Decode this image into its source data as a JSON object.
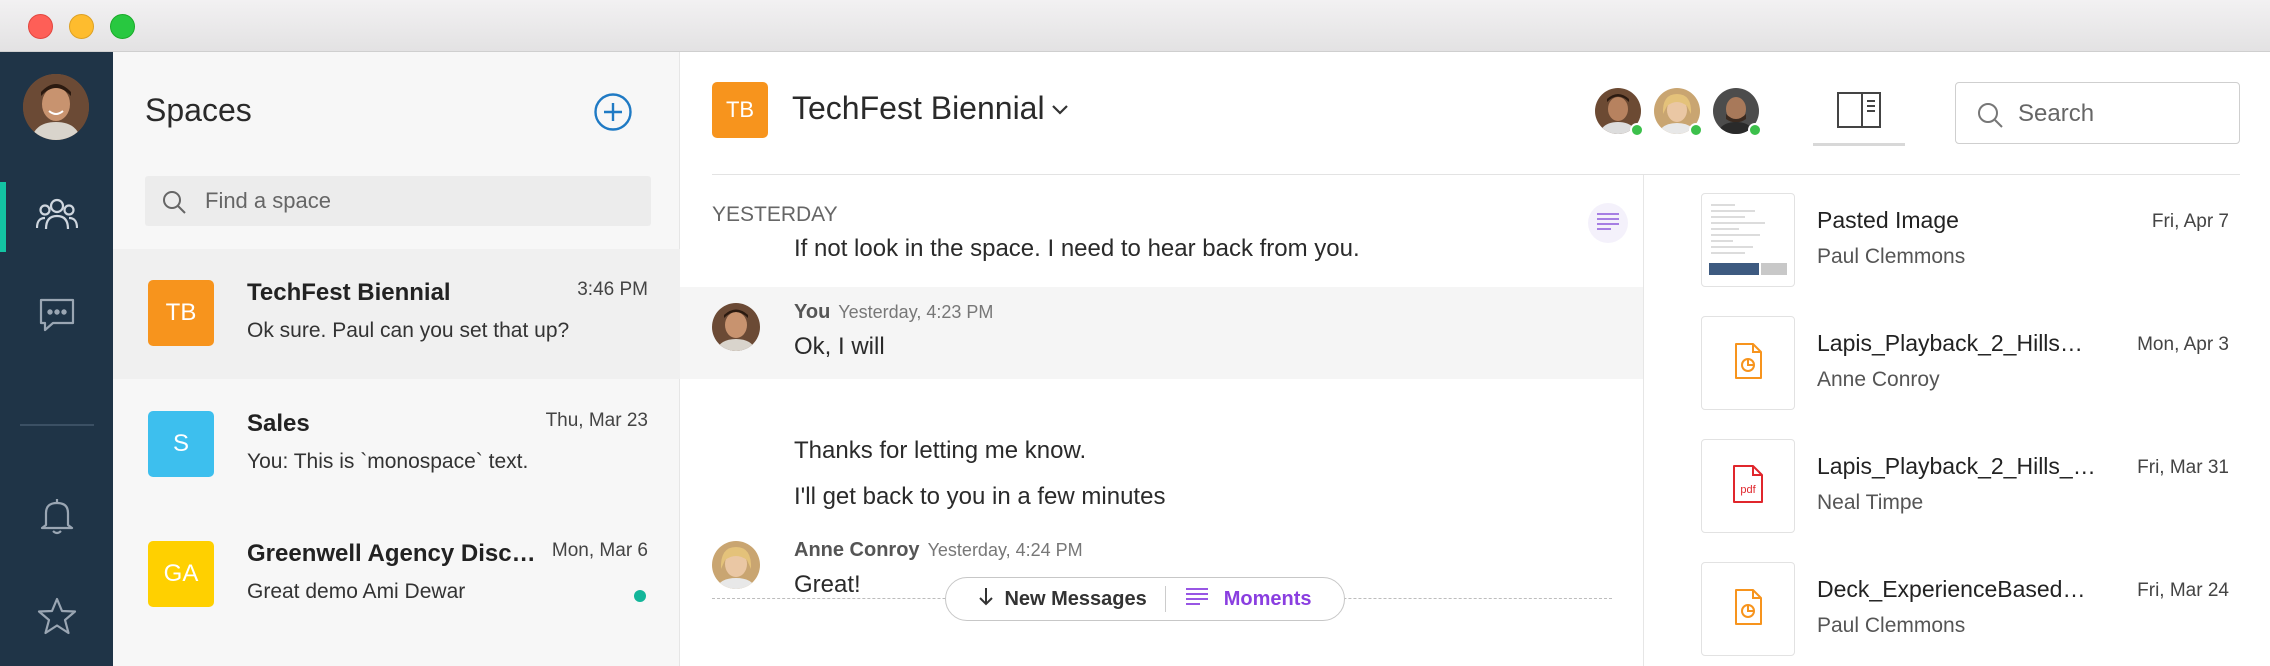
{
  "window": {
    "title": ""
  },
  "rail": {
    "items": [
      {
        "name": "spaces",
        "icon": "people-icon",
        "active": true
      },
      {
        "name": "messages",
        "icon": "chat-bubble-icon",
        "active": false
      },
      {
        "name": "notifications",
        "icon": "bell-icon",
        "active": false
      },
      {
        "name": "favorites",
        "icon": "star-icon",
        "active": false
      }
    ]
  },
  "spaces": {
    "title": "Spaces",
    "find_placeholder": "Find a space",
    "items": [
      {
        "initials": "TB",
        "color": "#f7941d",
        "name": "TechFest Biennial",
        "time": "3:46 PM",
        "preview": "Ok sure. Paul can you set that up?",
        "selected": true,
        "unread": false
      },
      {
        "initials": "S",
        "color": "#3dbfee",
        "name": "Sales",
        "time": "Thu, Mar 23",
        "preview": "You: This is `monospace` text.",
        "selected": false,
        "unread": false
      },
      {
        "initials": "GA",
        "color": "#ffd000",
        "name": "Greenwell Agency Discu…",
        "time": "Mon, Mar 6",
        "preview": "Great demo Ami Dewar",
        "selected": false,
        "unread": true
      }
    ]
  },
  "header": {
    "initials": "TB",
    "color": "#f7941d",
    "title": "TechFest Biennial",
    "search_placeholder": "Search"
  },
  "feed": {
    "day_label": "YESTERDAY",
    "first_line": "If not look in the space. I need to hear back from you.",
    "messages": [
      {
        "author": "You",
        "time": "Yesterday, 4:23 PM",
        "lines": [
          "Ok, I will",
          "Thanks for letting me know.",
          "I'll get back to you in a few minutes"
        ]
      },
      {
        "author": "Anne Conroy",
        "time": "Yesterday, 4:24 PM",
        "lines": [
          "Great!"
        ]
      }
    ],
    "new_messages_label": "New Messages",
    "moments_label": "Moments"
  },
  "files": [
    {
      "name": "Pasted Image",
      "date": "Fri, Apr 7",
      "owner": "Paul Clemmons",
      "type": "image"
    },
    {
      "name": "Lapis_Playback_2_Hills…",
      "date": "Mon, Apr 3",
      "owner": "Anne Conroy",
      "type": "presentation"
    },
    {
      "name": "Lapis_Playback_2_Hills_…",
      "date": "Fri, Mar 31",
      "owner": "Neal Timpe",
      "type": "pdf"
    },
    {
      "name": "Deck_ExperienceBased…",
      "date": "Fri, Mar 24",
      "owner": "Paul Clemmons",
      "type": "presentation"
    }
  ],
  "colors": {
    "rail": "#1f3447",
    "accent": "#13c4a3",
    "moments": "#8a3ee0",
    "pdf": "#e0262c",
    "presentation": "#f7941d"
  }
}
